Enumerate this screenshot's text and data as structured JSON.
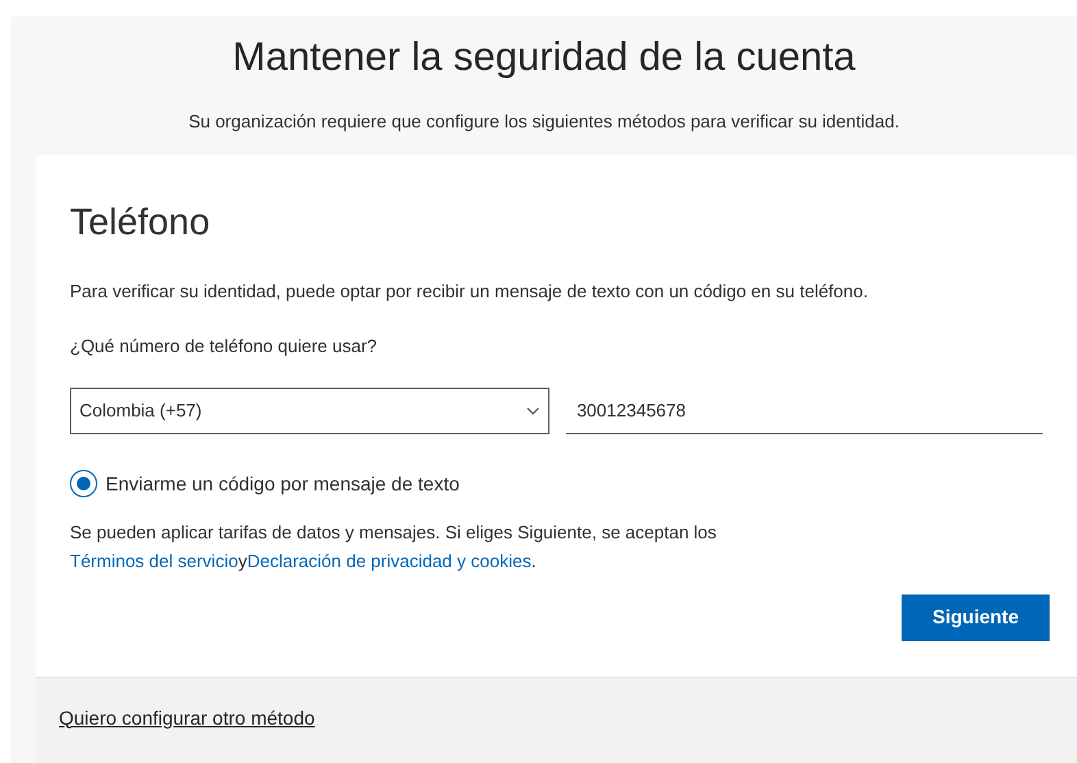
{
  "header": {
    "title": "Mantener la seguridad de la cuenta",
    "subtitle": "Su organización requiere que configure los siguientes métodos para verificar su identidad."
  },
  "card": {
    "title": "Teléfono",
    "description": "Para verificar su identidad, puede optar por recibir un mensaje de texto con un código en su teléfono.",
    "question": "¿Qué número de teléfono quiere usar?",
    "country_select": {
      "value": "Colombia (+57)"
    },
    "phone_field": {
      "value": "30012345678"
    },
    "options": [
      {
        "label": "Enviarme un código por mensaje de texto",
        "selected": true
      }
    ],
    "terms": {
      "text_before": "Se pueden aplicar tarifas de datos y mensajes. Si eliges Siguiente, se aceptan los ",
      "link_1": "Términos del servicio",
      "text_between": "y",
      "link_2": "Declaración de privacidad y cookies",
      "text_after": "."
    },
    "next_button": "Siguiente"
  },
  "footer": {
    "link": "Quiero configurar otro método"
  }
}
